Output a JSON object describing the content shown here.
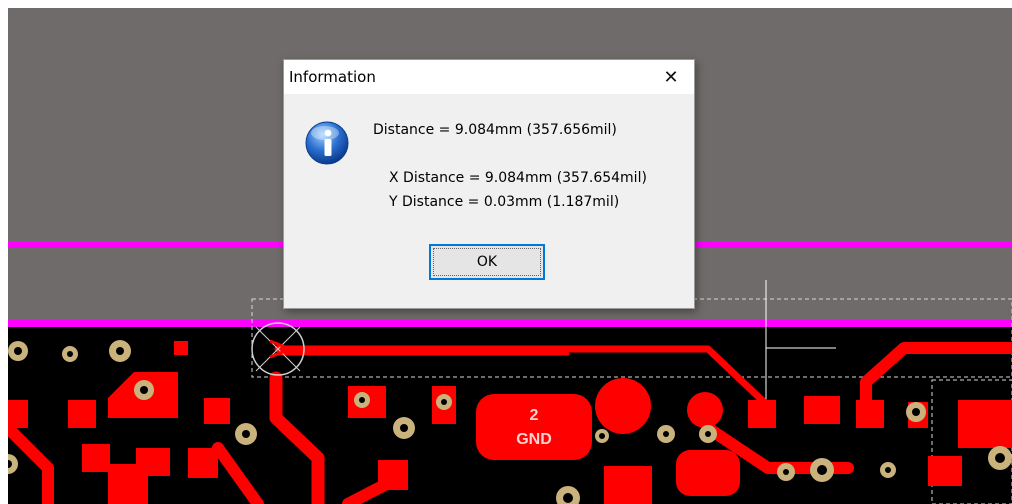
{
  "dialog": {
    "title": "Information",
    "close_glyph": "✕",
    "icon": "info-icon",
    "distance": "Distance = 9.084mm (357.656mil)",
    "x_distance": "X Distance = 9.084mm (357.654mil)",
    "y_distance": "Y Distance = 0.03mm (1.187mil)",
    "ok_label": "OK"
  },
  "pcb": {
    "pad_label_number": "2",
    "pad_label_net": "GND"
  },
  "colors": {
    "canvas_bg": "#6f6b6a",
    "board_black": "#000000",
    "copper_red": "#ff0000",
    "outline_magenta": "#ff00ff",
    "via_ring": "#c9b27c",
    "dialog_accent": "#0078d7"
  }
}
